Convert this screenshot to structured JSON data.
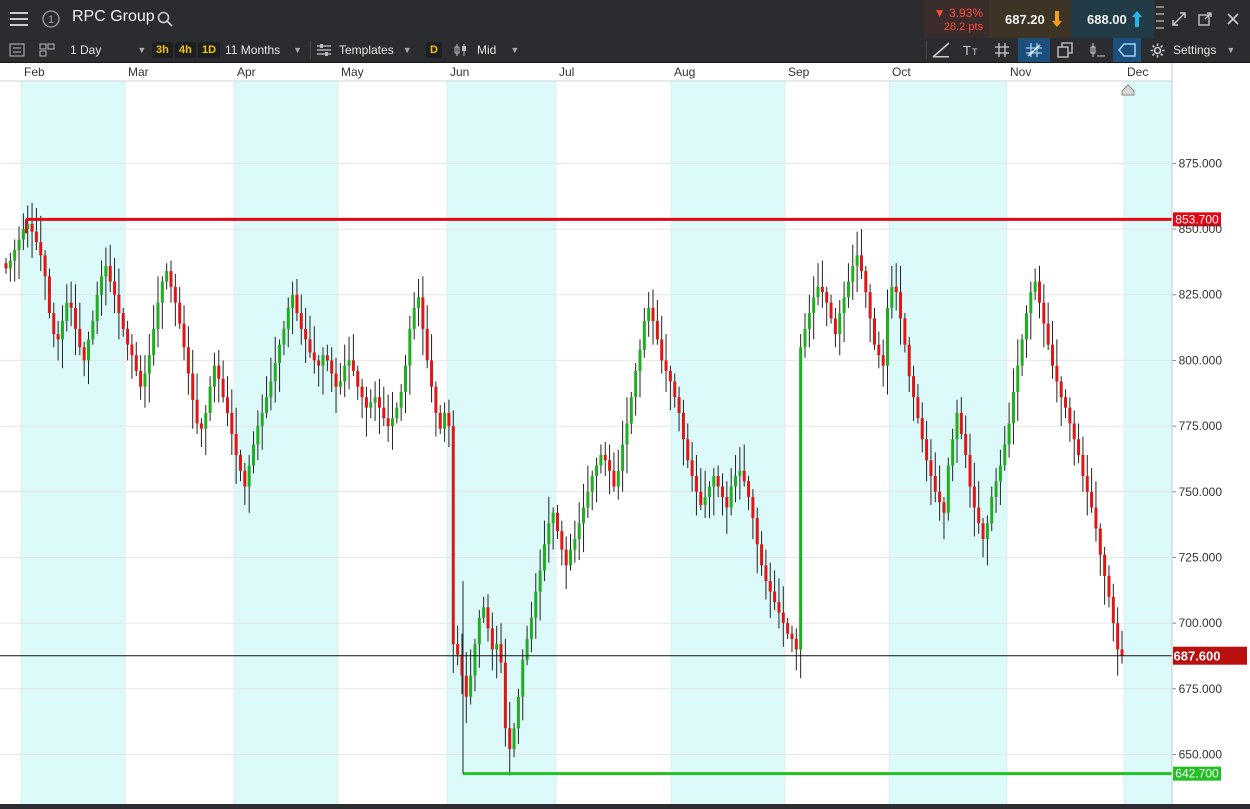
{
  "header": {
    "instrument": "RPC Group",
    "change_pct": "▼ 3.93%",
    "change_pts": "28.2 pts",
    "sell_price": "687.20",
    "buy_price": "688.00",
    "info_icon_label": "1"
  },
  "toolbar": {
    "interval": "1 Day",
    "tf_3h": "3h",
    "tf_4h": "4h",
    "tf_1d": "1D",
    "range": "11 Months",
    "templates": "Templates",
    "d_label": "D",
    "price_mode": "Mid",
    "settings": "Settings"
  },
  "colors": {
    "up": "#1fae1f",
    "down": "#e01616",
    "band": "#dcfafa",
    "resistance": "#e30613",
    "support": "#22c022",
    "current": "#b90f0f"
  },
  "chart_data": {
    "type": "candlestick",
    "x_axis_labels": [
      "Feb",
      "Mar",
      "Apr",
      "May",
      "Jun",
      "Jul",
      "Aug",
      "Sep",
      "Oct",
      "Nov",
      "Dec"
    ],
    "y_ticks": [
      "875.000",
      "850.000",
      "825.000",
      "800.000",
      "775.000",
      "750.000",
      "725.000",
      "700.000",
      "675.000",
      "650.000"
    ],
    "ylim": [
      638,
      882
    ],
    "resistance": {
      "value": 853.7,
      "label": "853.700"
    },
    "support": {
      "value": 642.7,
      "label": "642.700"
    },
    "last_price": {
      "value": 687.6,
      "label": "687.600"
    },
    "close_series": [
      835,
      838,
      842,
      846,
      850,
      852,
      849,
      845,
      840,
      832,
      818,
      810,
      808,
      815,
      822,
      820,
      812,
      805,
      800,
      808,
      815,
      825,
      832,
      836,
      830,
      825,
      818,
      812,
      806,
      802,
      796,
      790,
      795,
      802,
      812,
      822,
      830,
      834,
      828,
      822,
      814,
      805,
      795,
      785,
      776,
      774,
      780,
      790,
      798,
      793,
      786,
      780,
      772,
      764,
      758,
      752,
      760,
      768,
      775,
      780,
      786,
      792,
      799,
      806,
      812,
      820,
      825,
      818,
      812,
      808,
      803,
      800,
      798,
      802,
      800,
      795,
      790,
      792,
      798,
      800,
      796,
      790,
      786,
      782,
      784,
      786,
      782,
      778,
      775,
      778,
      782,
      788,
      798,
      812,
      820,
      824,
      812,
      800,
      790,
      780,
      774,
      780,
      775,
      692,
      688,
      680,
      672,
      680,
      692,
      702,
      706,
      698,
      690,
      692,
      685,
      660,
      652,
      660,
      672,
      686,
      694,
      702,
      712,
      720,
      730,
      738,
      742,
      735,
      728,
      722,
      728,
      732,
      738,
      744,
      750,
      756,
      760,
      764,
      762,
      758,
      752,
      758,
      768,
      776,
      786,
      796,
      804,
      815,
      820,
      815,
      808,
      800,
      796,
      792,
      786,
      780,
      770,
      762,
      756,
      750,
      745,
      748,
      752,
      756,
      752,
      748,
      744,
      752,
      756,
      758,
      754,
      748,
      740,
      730,
      722,
      716,
      712,
      708,
      704,
      700,
      696,
      694,
      690,
      805,
      812,
      818,
      824,
      828,
      826,
      822,
      816,
      810,
      818,
      824,
      830,
      836,
      840,
      834,
      826,
      816,
      806,
      802,
      798,
      820,
      828,
      826,
      816,
      806,
      794,
      786,
      778,
      770,
      762,
      756,
      750,
      746,
      742,
      760,
      770,
      780,
      772,
      764,
      752,
      744,
      738,
      732,
      738,
      748,
      754,
      760,
      768,
      776,
      788,
      798,
      808,
      818,
      826,
      830,
      822,
      814,
      806,
      798,
      792,
      786,
      782,
      776,
      770,
      764,
      756,
      750,
      744,
      736,
      726,
      718,
      710,
      700,
      690,
      687.6
    ]
  }
}
